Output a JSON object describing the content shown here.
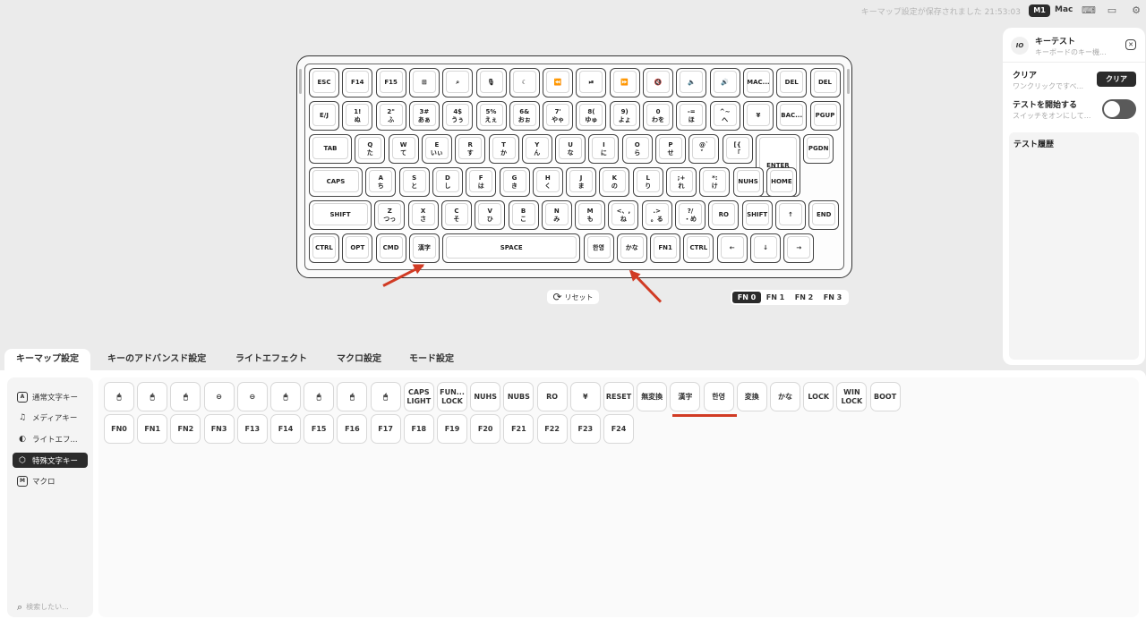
{
  "topbar": {
    "save_status": "キーマップ設定が保存されました 21:53:03",
    "profile": "M1",
    "os": "Mac",
    "icons": [
      "keyboard-icon",
      "chat-icon",
      "gear-icon"
    ]
  },
  "keyboard": {
    "rows": [
      [
        {
          "l1": "ESC"
        },
        {
          "l1": "F14"
        },
        {
          "l1": "F15"
        },
        {
          "l1": "⊞"
        },
        {
          "l1": "⌕"
        },
        {
          "l1": "🎙"
        },
        {
          "l1": "☾"
        },
        {
          "l1": "⏪"
        },
        {
          "l1": "⏯"
        },
        {
          "l1": "⏩"
        },
        {
          "l1": "🔇"
        },
        {
          "l1": "🔈"
        },
        {
          "l1": "🔊"
        },
        {
          "l1": "MAC..."
        },
        {
          "l1": "DEL"
        },
        {
          "l1": "DEL"
        }
      ],
      [
        {
          "l1": "E/J"
        },
        {
          "l1": "1!",
          "l2": "ぬ"
        },
        {
          "l1": "2\"",
          "l2": "ふ"
        },
        {
          "l1": "3#",
          "l2": "あぁ"
        },
        {
          "l1": "4$",
          "l2": "うぅ"
        },
        {
          "l1": "5%",
          "l2": "えぇ"
        },
        {
          "l1": "6&",
          "l2": "おぉ"
        },
        {
          "l1": "7'",
          "l2": "やゃ"
        },
        {
          "l1": "8(",
          "l2": "ゆゅ"
        },
        {
          "l1": "9)",
          "l2": "よょ"
        },
        {
          "l1": "0",
          "l2": "わを"
        },
        {
          "l1": "-=",
          "l2": "ほ"
        },
        {
          "l1": "^~",
          "l2": "へ"
        },
        {
          "l1": "¥"
        },
        {
          "l1": "BAC..."
        },
        {
          "l1": "PGUP"
        }
      ],
      [
        {
          "l1": "TAB"
        },
        {
          "l1": "Q",
          "l2": "た"
        },
        {
          "l1": "W",
          "l2": "て"
        },
        {
          "l1": "E",
          "l2": "いぃ"
        },
        {
          "l1": "R",
          "l2": "す"
        },
        {
          "l1": "T",
          "l2": "か"
        },
        {
          "l1": "Y",
          "l2": "ん"
        },
        {
          "l1": "U",
          "l2": "な"
        },
        {
          "l1": "I",
          "l2": "に"
        },
        {
          "l1": "O",
          "l2": "ら"
        },
        {
          "l1": "P",
          "l2": "せ"
        },
        {
          "l1": "@`",
          "l2": "゛"
        },
        {
          "l1": "[{",
          "l2": "「"
        },
        {
          "l1": "ENTER"
        },
        {
          "l1": "PGDN"
        }
      ],
      [
        {
          "l1": "CAPS"
        },
        {
          "l1": "A",
          "l2": "ち"
        },
        {
          "l1": "S",
          "l2": "と"
        },
        {
          "l1": "D",
          "l2": "し"
        },
        {
          "l1": "F",
          "l2": "は"
        },
        {
          "l1": "G",
          "l2": "き"
        },
        {
          "l1": "H",
          "l2": "く"
        },
        {
          "l1": "J",
          "l2": "ま"
        },
        {
          "l1": "K",
          "l2": "の"
        },
        {
          "l1": "L",
          "l2": "り"
        },
        {
          "l1": ";+",
          "l2": "れ"
        },
        {
          "l1": "*:",
          "l2": "け"
        },
        {
          "l1": "NUHS"
        },
        {
          "l1": "HOME"
        }
      ],
      [
        {
          "l1": "SHIFT"
        },
        {
          "l1": "Z",
          "l2": "つっ"
        },
        {
          "l1": "X",
          "l2": "さ"
        },
        {
          "l1": "C",
          "l2": "そ"
        },
        {
          "l1": "V",
          "l2": "ひ"
        },
        {
          "l1": "B",
          "l2": "こ"
        },
        {
          "l1": "N",
          "l2": "み"
        },
        {
          "l1": "M",
          "l2": "も"
        },
        {
          "l1": "<、,",
          "l2": "ね"
        },
        {
          "l1": ".>",
          "l2": "。る"
        },
        {
          "l1": "?/",
          "l2": "・め"
        },
        {
          "l1": "RO"
        },
        {
          "l1": "SHIFT"
        },
        {
          "l1": "↑"
        },
        {
          "l1": "END"
        }
      ],
      [
        {
          "l1": "CTRL"
        },
        {
          "l1": "OPT"
        },
        {
          "l1": "CMD"
        },
        {
          "l1": "漢字"
        },
        {
          "l1": "SPACE"
        },
        {
          "l1": "한영"
        },
        {
          "l1": "かな"
        },
        {
          "l1": "FN1"
        },
        {
          "l1": "CTRL"
        },
        {
          "l1": "←"
        },
        {
          "l1": "↓"
        },
        {
          "l1": "→"
        }
      ]
    ]
  },
  "reset_label": "リセット",
  "fn_layers": [
    "FN 0",
    "FN 1",
    "FN 2",
    "FN 3"
  ],
  "panel": {
    "avatar": "IO",
    "title": "キーテスト",
    "subtitle": "キーボードのキー機...",
    "clear_label": "クリア",
    "clear_desc": "ワンクリックですべ...",
    "clear_button": "クリア",
    "start_label": "テストを開始する",
    "start_desc": "スイッチをオンにして...",
    "history_title": "テスト履歴"
  },
  "tabs": [
    "キーマップ設定",
    "キーのアドバンスド設定",
    "ライトエフェクト",
    "マクロ設定",
    "モード設定"
  ],
  "nav": {
    "items": [
      {
        "icon": "A",
        "label": "通常文字キー"
      },
      {
        "icon": "♫",
        "label": "メディアキー"
      },
      {
        "icon": "◐",
        "label": "ライトエフ..."
      },
      {
        "icon": "⬡",
        "label": "特殊文字キー"
      },
      {
        "icon": "M",
        "label": "マクロ"
      }
    ],
    "search_placeholder": "検索したい..."
  },
  "special_keys": {
    "row1": [
      "🖱",
      "🖱",
      "🖱",
      "⊖",
      "⊖",
      "🖱",
      "🖱",
      "🖱",
      "🖱",
      "CAPS LIGHT",
      "FUN... LOCK",
      "NUHS",
      "NUBS",
      "RO",
      "¥",
      "RESET",
      "無変換",
      "漢字",
      "한영",
      "変換",
      "かな",
      "LOCK",
      "WIN LOCK",
      "BOOT"
    ],
    "row2": [
      "FN0",
      "FN1",
      "FN2",
      "FN3",
      "F13",
      "F14",
      "F15",
      "F16",
      "F17",
      "F18",
      "F19",
      "F20",
      "F21",
      "F22",
      "F23",
      "F24"
    ]
  },
  "accent_color": "#d13b24"
}
